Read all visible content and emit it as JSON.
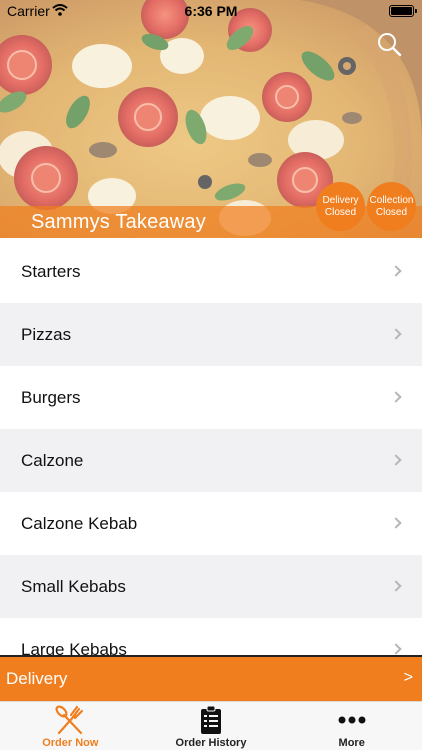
{
  "status_bar": {
    "carrier": "Carrier",
    "time": "6:36 PM"
  },
  "header": {
    "store_name": "Sammys Takeaway",
    "delivery_status": {
      "line1": "Delivery",
      "line2": "Closed"
    },
    "collection_status": {
      "line1": "Collection",
      "line2": "Closed"
    },
    "search_icon": "search-icon"
  },
  "menu": {
    "categories": [
      {
        "label": "Starters"
      },
      {
        "label": "Pizzas"
      },
      {
        "label": "Burgers"
      },
      {
        "label": "Calzone"
      },
      {
        "label": "Calzone Kebab"
      },
      {
        "label": "Small Kebabs"
      },
      {
        "label": "Large Kebabs"
      }
    ]
  },
  "order_mode": {
    "label": "Delivery",
    "arrow": ">"
  },
  "tab_bar": {
    "tabs": [
      {
        "label": "Order Now",
        "icon": "fork-knife-icon",
        "active": true
      },
      {
        "label": "Order History",
        "icon": "clipboard-list-icon",
        "active": false
      },
      {
        "label": "More",
        "icon": "more-dots-icon",
        "active": false
      }
    ]
  },
  "colors": {
    "accent": "#f07e1e",
    "row_alt": "#f1f1f4",
    "tab_bar_bg": "#f7f7f7"
  }
}
